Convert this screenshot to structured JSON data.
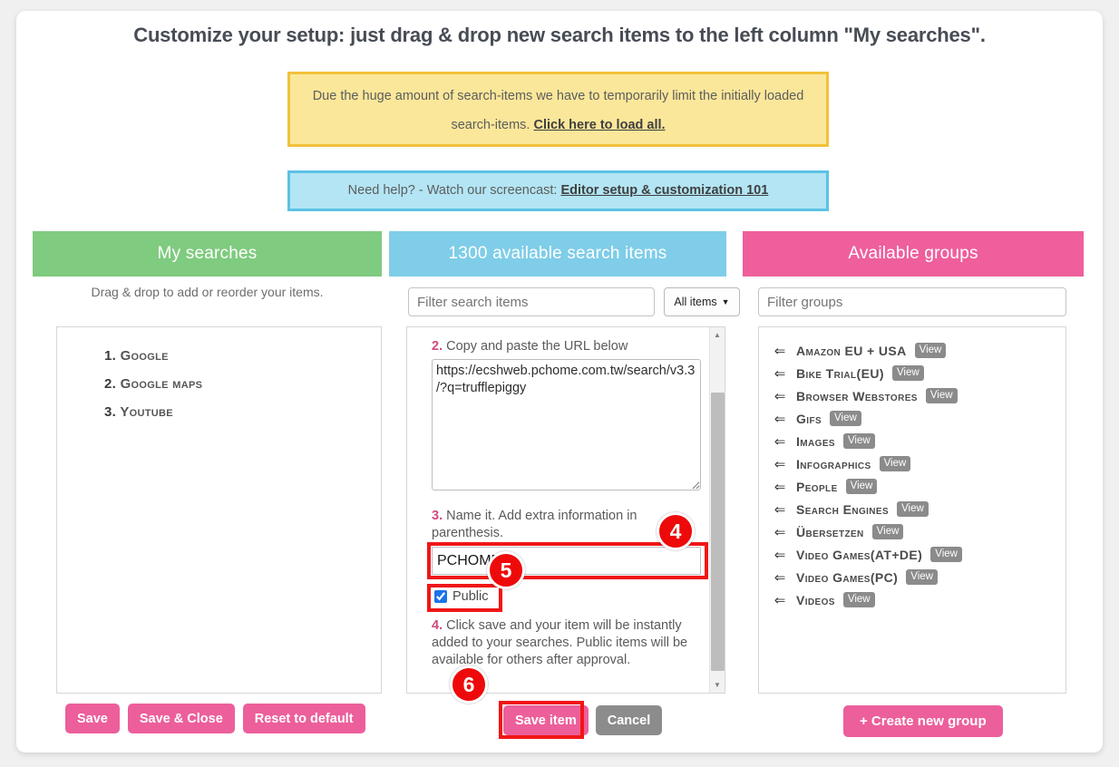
{
  "page": {
    "title": "Customize your setup: just drag & drop new search items to the left column \"My searches\"."
  },
  "notices": {
    "yellow": {
      "text": "Due the huge amount of search-items we have to temporarily limit the initially loaded search-items.",
      "link": "Click here to load all."
    },
    "blue": {
      "text": "Need help? - Watch our screencast:",
      "link": "Editor setup & customization 101"
    }
  },
  "columns": {
    "left": {
      "header": "My searches",
      "hint": "Drag & drop to add or reorder your items.",
      "items": [
        {
          "num": "1.",
          "name": "Google"
        },
        {
          "num": "2.",
          "name": "Google maps"
        },
        {
          "num": "3.",
          "name": "Youtube"
        }
      ]
    },
    "middle": {
      "header": "1300 available search items",
      "filter_placeholder": "Filter search items",
      "filter_value": "",
      "select_value": "All items",
      "select_options": [
        "All items"
      ],
      "form": {
        "step2_num": "2.",
        "step2_text": "Copy and paste the URL below",
        "url_value": "https://ecshweb.pchome.com.tw/search/v3.3/?q=trufflepiggy",
        "step3_num": "3.",
        "step3_text": "Name it. Add extra information in parenthesis.",
        "name_value": "PCHOME24",
        "public_label": "Public",
        "public_checked": true,
        "step4_num": "4.",
        "step4_text": "Click save and your item will be instantly added to your searches. Public items will be available for others after approval."
      }
    },
    "right": {
      "header": "Available groups",
      "filter_placeholder": "Filter groups",
      "filter_value": "",
      "view_label": "View",
      "arrow_icon": "⇐",
      "groups": [
        "Amazon EU + USA",
        "Bike Trial(EU)",
        "Browser Webstores",
        "Gifs",
        "Images",
        "Infographics",
        "People",
        "Search Engines",
        "Übersetzen",
        "Video Games(AT+DE)",
        "Video Games(PC)",
        "Videos"
      ]
    }
  },
  "footer": {
    "save": "Save",
    "save_close": "Save & Close",
    "reset": "Reset to default",
    "save_item": "Save item",
    "cancel": "Cancel",
    "create_group": "+ Create new group"
  },
  "annotations": {
    "badge4": "4",
    "badge5": "5",
    "badge6": "6"
  },
  "colors": {
    "green": "#7fcb7f",
    "blue": "#7fcde8",
    "pink": "#ee5f9c",
    "yellow_bg": "#fbe79a",
    "yellow_border": "#f2c13a",
    "blue_bg": "#b3e5f4",
    "blue_border": "#5dc2e3",
    "annotation_red": "#ee0a0a",
    "accent_pink": "#d1497e"
  }
}
